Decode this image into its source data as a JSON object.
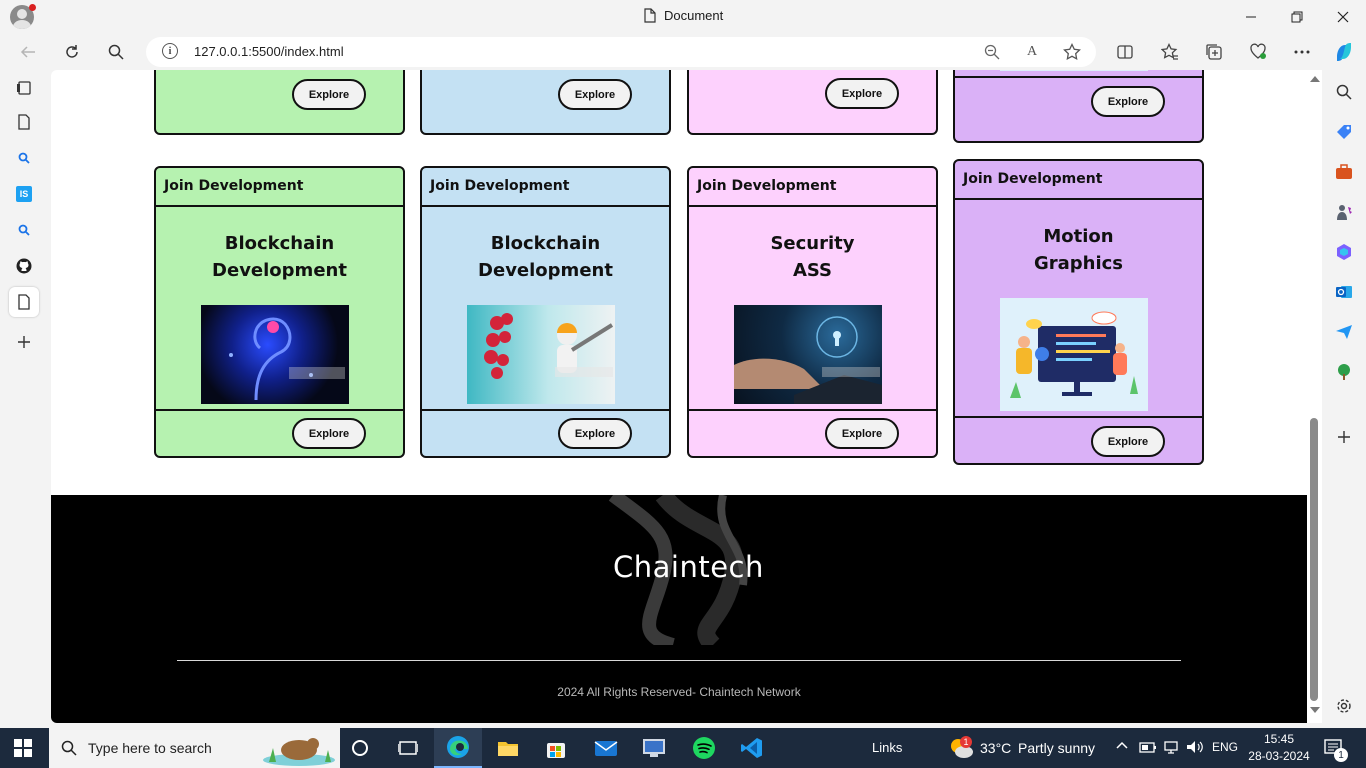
{
  "browser": {
    "tab_title": "Document",
    "url": "127.0.0.1:5500/index.html"
  },
  "top_cards": [
    {
      "button": "Explore",
      "color": "#b6f2b0"
    },
    {
      "button": "Explore",
      "color": "#c4e1f3"
    },
    {
      "button": "Explore",
      "color": "#fdd1fd"
    },
    {
      "button": "Explore",
      "color": "#dab1f7"
    }
  ],
  "cards": [
    {
      "header": "Join Development",
      "line1": "Blockchain",
      "line2": "Development",
      "button": "Explore",
      "color": "#b6f2b0"
    },
    {
      "header": "Join Development",
      "line1": "Blockchain",
      "line2": "Development",
      "button": "Explore",
      "color": "#c4e1f3"
    },
    {
      "header": "Join Development",
      "line1": "Security",
      "line2": "ASS",
      "button": "Explore",
      "color": "#fdd1fd"
    },
    {
      "header": "Join Development",
      "line1": "Motion",
      "line2": "Graphics",
      "button": "Explore",
      "color": "#dab1f7"
    }
  ],
  "footer": {
    "logo": "Chaintech",
    "copyright": "2024 All Rights Reserved- Chaintech Network"
  },
  "taskbar": {
    "search_placeholder": "Type here to search",
    "links": "Links",
    "temperature": "33°C",
    "weather": "Partly sunny",
    "weather_badge": "1",
    "language": "ENG",
    "time": "15:45",
    "date": "28-03-2024",
    "notifications": "1"
  }
}
